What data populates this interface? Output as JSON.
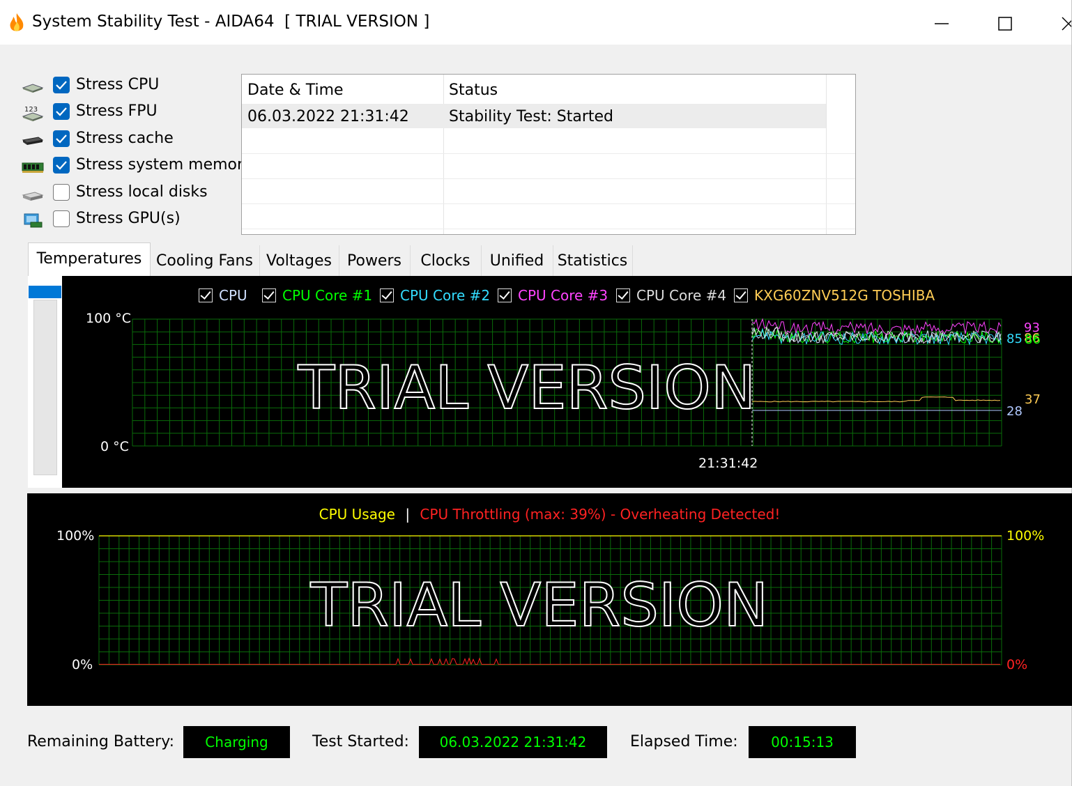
{
  "window": {
    "title": "System Stability Test - AIDA64  [ TRIAL VERSION ]",
    "app_icon": "aida64-flame-icon",
    "controls": [
      "minimize-icon",
      "maximize-icon",
      "close-icon"
    ]
  },
  "stress_options": [
    {
      "label": "Stress CPU",
      "checked": true,
      "icon": "cpu-chip-icon"
    },
    {
      "label": "Stress FPU",
      "checked": true,
      "icon": "fpu-123-icon"
    },
    {
      "label": "Stress cache",
      "checked": true,
      "icon": "cache-chip-icon"
    },
    {
      "label": "Stress system memory",
      "checked": true,
      "icon": "memory-module-icon"
    },
    {
      "label": "Stress local disks",
      "checked": false,
      "icon": "hard-disk-icon"
    },
    {
      "label": "Stress GPU(s)",
      "checked": false,
      "icon": "gpu-card-icon"
    }
  ],
  "log": {
    "columns": [
      "Date & Time",
      "Status"
    ],
    "rows": [
      {
        "datetime": "06.03.2022 21:31:42",
        "status": "Stability Test: Started"
      }
    ]
  },
  "tabs": [
    {
      "label": "Temperatures",
      "active": true
    },
    {
      "label": "Cooling Fans",
      "active": false
    },
    {
      "label": "Voltages",
      "active": false
    },
    {
      "label": "Powers",
      "active": false
    },
    {
      "label": "Clocks",
      "active": false
    },
    {
      "label": "Unified",
      "active": false
    },
    {
      "label": "Statistics",
      "active": false
    }
  ],
  "temperature_chart": {
    "legend": [
      {
        "name": "CPU",
        "color": "#d0e0ff",
        "checked": true
      },
      {
        "name": "CPU Core #1",
        "color": "#00ff00",
        "checked": true
      },
      {
        "name": "CPU Core #2",
        "color": "#33ddff",
        "checked": true
      },
      {
        "name": "CPU Core #3",
        "color": "#ff44ff",
        "checked": true
      },
      {
        "name": "CPU Core #4",
        "color": "#dddddd",
        "checked": true
      },
      {
        "name": "KXG60ZNV512G TOSHIBA",
        "color": "#ffcc55",
        "checked": true
      }
    ],
    "y_max_label": "100 °C",
    "y_min_label": "0 °C",
    "x_marker_label": "21:31:42",
    "watermark": "TRIAL VERSION",
    "current_values": [
      {
        "text": "93",
        "color": "#ff44ff"
      },
      {
        "text": "86",
        "color": "#ffcc55"
      },
      {
        "text": "85",
        "color": "#33ddff"
      },
      {
        "text": "86",
        "color": "#00ff00"
      },
      {
        "text": "37",
        "color": "#ffcc55"
      },
      {
        "text": "28",
        "color": "#b0c8ff"
      }
    ]
  },
  "usage_chart": {
    "title_usage": "CPU Usage",
    "separator": "|",
    "title_throttling": "CPU Throttling (max: 39%) - Overheating Detected!",
    "usage_color": "#ffff00",
    "throttle_color": "#ff2222",
    "y_max_left": "100%",
    "y_min_left": "0%",
    "y_max_right": "100%",
    "y_min_right": "0%",
    "watermark": "TRIAL VERSION"
  },
  "status_bar": {
    "battery_label": "Remaining Battery:",
    "battery_value": "Charging",
    "started_label": "Test Started:",
    "started_value": "06.03.2022 21:31:42",
    "elapsed_label": "Elapsed Time:",
    "elapsed_value": "00:15:13"
  },
  "chart_data": [
    {
      "type": "line",
      "title": "",
      "ylabel": "°C",
      "ylim": [
        0,
        100
      ],
      "x_marker": "21:31:42",
      "grid": true,
      "series": [
        {
          "name": "CPU",
          "current": 86
        },
        {
          "name": "CPU Core #1",
          "current": 86
        },
        {
          "name": "CPU Core #2",
          "current": 85
        },
        {
          "name": "CPU Core #3",
          "current": 93
        },
        {
          "name": "CPU Core #4",
          "current": 86
        },
        {
          "name": "KXG60ZNV512G TOSHIBA",
          "current": 37
        }
      ],
      "reference_value": 28
    },
    {
      "type": "line",
      "title": "CPU Usage | CPU Throttling (max: 39%) - Overheating Detected!",
      "ylim": [
        0,
        100
      ],
      "grid": true,
      "series": [
        {
          "name": "CPU Usage",
          "current": 100
        },
        {
          "name": "CPU Throttling",
          "max": 39,
          "current": 0
        }
      ]
    }
  ]
}
